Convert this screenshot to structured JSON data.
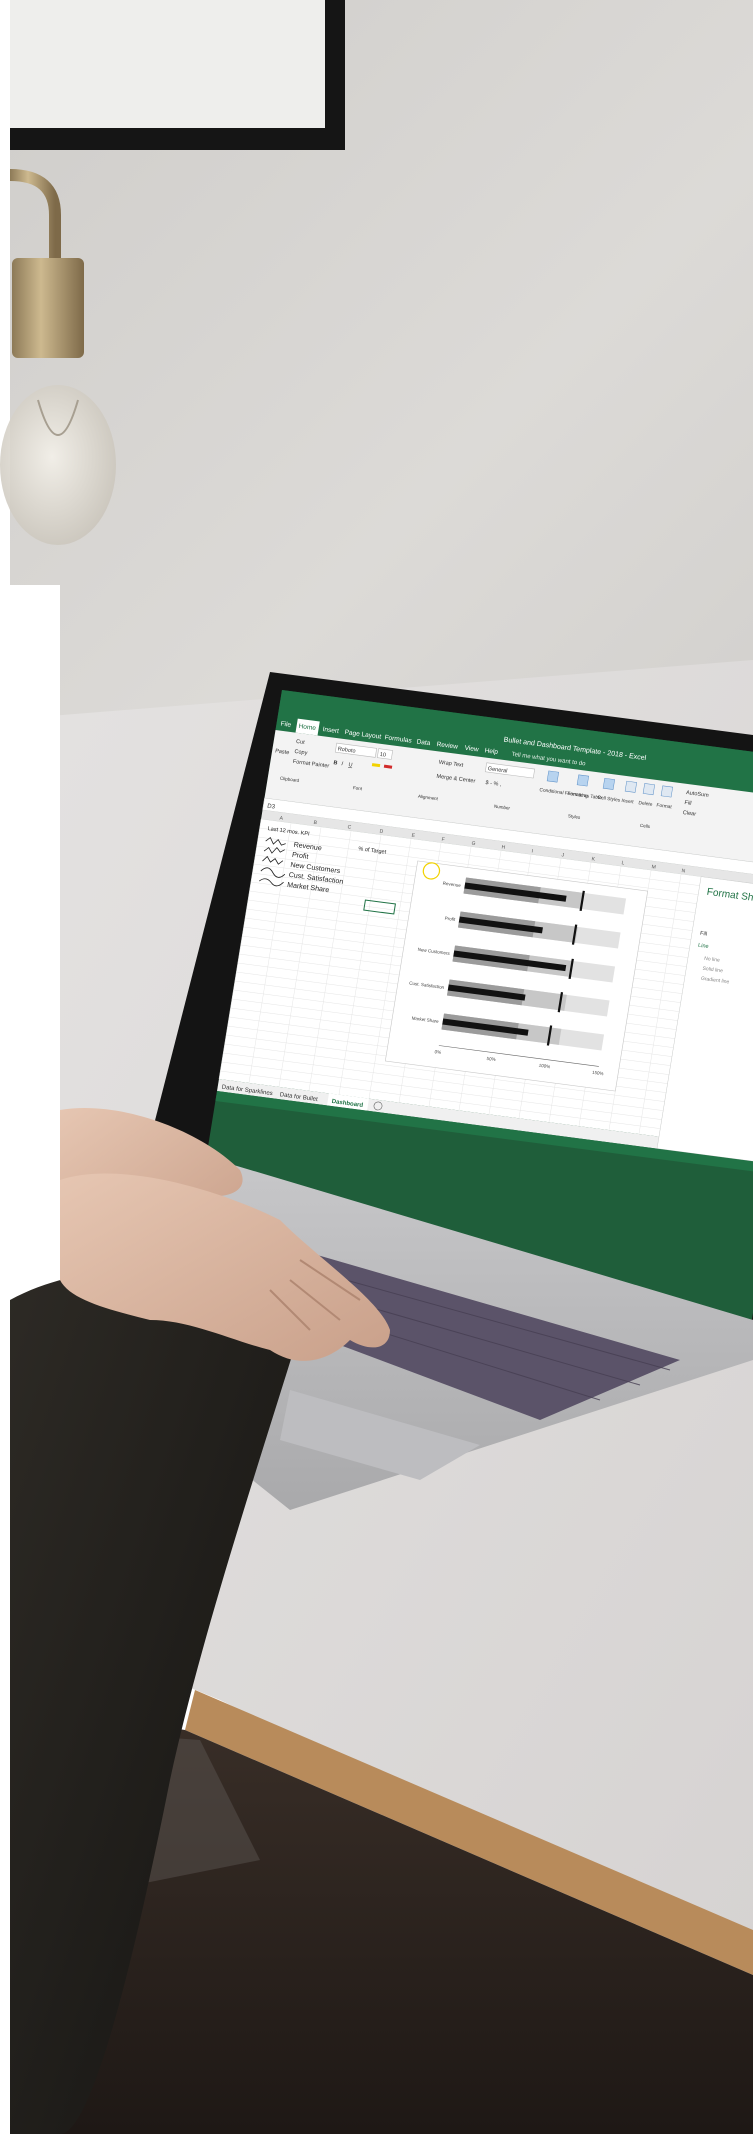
{
  "excel": {
    "title": "Bullet and Dashboard Template - 2018 - Excel",
    "tell_me": "Tell me what you want to do",
    "tabs": [
      "File",
      "Home",
      "Insert",
      "Page Layout",
      "Formulas",
      "Data",
      "Review",
      "View",
      "Help"
    ],
    "ribbon": {
      "cut": "Cut",
      "copy": "Copy",
      "format_painter": "Format Painter",
      "paste": "Paste",
      "clipboard": "Clipboard",
      "font_name": "Roboto",
      "font_size": "10",
      "font_group": "Font",
      "wrap_text": "Wrap Text",
      "merge_center": "Merge & Center",
      "alignment": "Alignment",
      "number_format": "General",
      "number_group": "Number",
      "conditional_formatting": "Conditional Formatting",
      "format_as_table": "Format as Table",
      "cell_styles": "Cell Styles",
      "styles_group": "Styles",
      "insert": "Insert",
      "delete": "Delete",
      "format": "Format",
      "cells_group": "Cells",
      "autosum": "AutoSum",
      "fill": "Fill",
      "clear": "Clear"
    },
    "name_box": "D3",
    "columns": [
      "A",
      "B",
      "C",
      "D",
      "E",
      "F",
      "G",
      "H",
      "I",
      "J",
      "K",
      "L",
      "M",
      "N"
    ],
    "sheet": {
      "heading": "Last 12 mos. KPI",
      "target_header": "% of Target",
      "kpis": [
        "Revenue",
        "Profit",
        "New Customers",
        "Cust. Satisfaction",
        "Market Share"
      ]
    },
    "chart_data": {
      "type": "bar",
      "categories": [
        "Revenue",
        "Profit",
        "New Customers",
        "Cust. Satisfaction",
        "Market Share"
      ],
      "x_ticks": [
        "0%",
        "50%",
        "100%",
        "150%"
      ],
      "xlim": [
        0,
        150
      ],
      "series": [
        {
          "values": [
            95,
            78,
            105,
            72,
            80
          ]
        }
      ],
      "targets": [
        110,
        108,
        110,
        105,
        100
      ]
    },
    "sheet_tabs": [
      "Data for Sparklines",
      "Data for Bullet",
      "Dashboard"
    ],
    "format_pane": {
      "title": "Format Shape",
      "fill": "Fill",
      "line": "Line",
      "no_line": "No line",
      "solid_line": "Solid line",
      "gradient_line": "Gradient line"
    }
  }
}
